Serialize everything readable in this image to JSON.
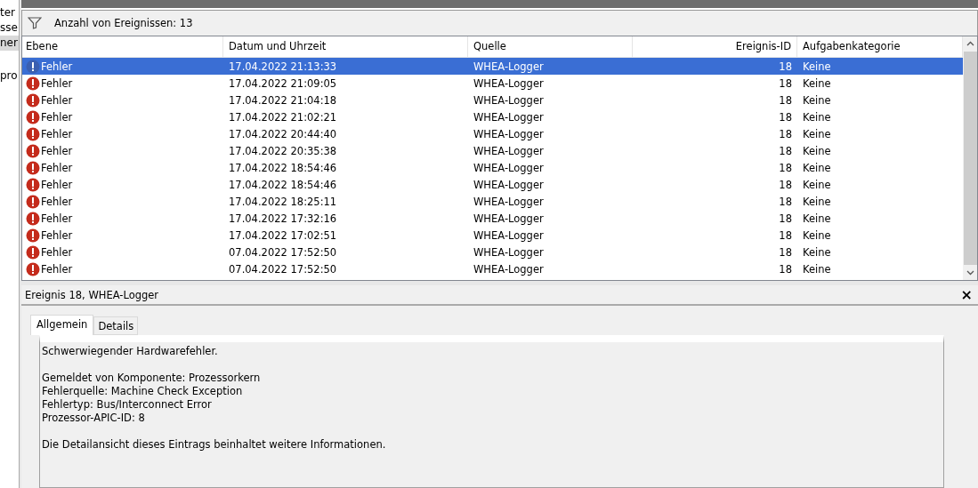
{
  "sidebar": {
    "items": [
      {
        "label": "ter",
        "selected": false
      },
      {
        "label": "sse",
        "selected": false
      },
      {
        "label": "ner",
        "selected": true
      },
      {
        "label": "pro",
        "selected": false
      }
    ]
  },
  "filter_bar": {
    "text": "Anzahl von Ereignissen: 13"
  },
  "table": {
    "columns": [
      "Ebene",
      "Datum und Uhrzeit",
      "Quelle",
      "Ereignis-ID",
      "Aufgabenkategorie"
    ],
    "rows": [
      {
        "level": "Fehler",
        "date": "17.04.2022 21:13:33",
        "source": "WHEA-Logger",
        "id": "18",
        "category": "Keine",
        "selected": true
      },
      {
        "level": "Fehler",
        "date": "17.04.2022 21:09:05",
        "source": "WHEA-Logger",
        "id": "18",
        "category": "Keine",
        "selected": false
      },
      {
        "level": "Fehler",
        "date": "17.04.2022 21:04:18",
        "source": "WHEA-Logger",
        "id": "18",
        "category": "Keine",
        "selected": false
      },
      {
        "level": "Fehler",
        "date": "17.04.2022 21:02:21",
        "source": "WHEA-Logger",
        "id": "18",
        "category": "Keine",
        "selected": false
      },
      {
        "level": "Fehler",
        "date": "17.04.2022 20:44:40",
        "source": "WHEA-Logger",
        "id": "18",
        "category": "Keine",
        "selected": false
      },
      {
        "level": "Fehler",
        "date": "17.04.2022 20:35:38",
        "source": "WHEA-Logger",
        "id": "18",
        "category": "Keine",
        "selected": false
      },
      {
        "level": "Fehler",
        "date": "17.04.2022 18:54:46",
        "source": "WHEA-Logger",
        "id": "18",
        "category": "Keine",
        "selected": false
      },
      {
        "level": "Fehler",
        "date": "17.04.2022 18:54:46",
        "source": "WHEA-Logger",
        "id": "18",
        "category": "Keine",
        "selected": false
      },
      {
        "level": "Fehler",
        "date": "17.04.2022 18:25:11",
        "source": "WHEA-Logger",
        "id": "18",
        "category": "Keine",
        "selected": false
      },
      {
        "level": "Fehler",
        "date": "17.04.2022 17:32:16",
        "source": "WHEA-Logger",
        "id": "18",
        "category": "Keine",
        "selected": false
      },
      {
        "level": "Fehler",
        "date": "17.04.2022 17:02:51",
        "source": "WHEA-Logger",
        "id": "18",
        "category": "Keine",
        "selected": false
      },
      {
        "level": "Fehler",
        "date": "07.04.2022 17:52:50",
        "source": "WHEA-Logger",
        "id": "18",
        "category": "Keine",
        "selected": false
      },
      {
        "level": "Fehler",
        "date": "07.04.2022 17:52:50",
        "source": "WHEA-Logger",
        "id": "18",
        "category": "Keine",
        "selected": false
      }
    ]
  },
  "detail": {
    "title": "Ereignis 18, WHEA-Logger",
    "close": "×",
    "tabs": [
      {
        "label": "Allgemein",
        "selected": true
      },
      {
        "label": "Details",
        "selected": false
      }
    ],
    "paragraphs": [
      [
        "Schwerwiegender Hardwarefehler."
      ],
      [
        "Gemeldet von Komponente: Prozessorkern",
        "Fehlerquelle: Machine Check Exception",
        "Fehlertyp: Bus/Interconnect Error",
        "Prozessor-APIC-ID: 8"
      ],
      [
        "Die Detailansicht dieses Eintrags beinhaltet weitere Informationen."
      ]
    ]
  }
}
